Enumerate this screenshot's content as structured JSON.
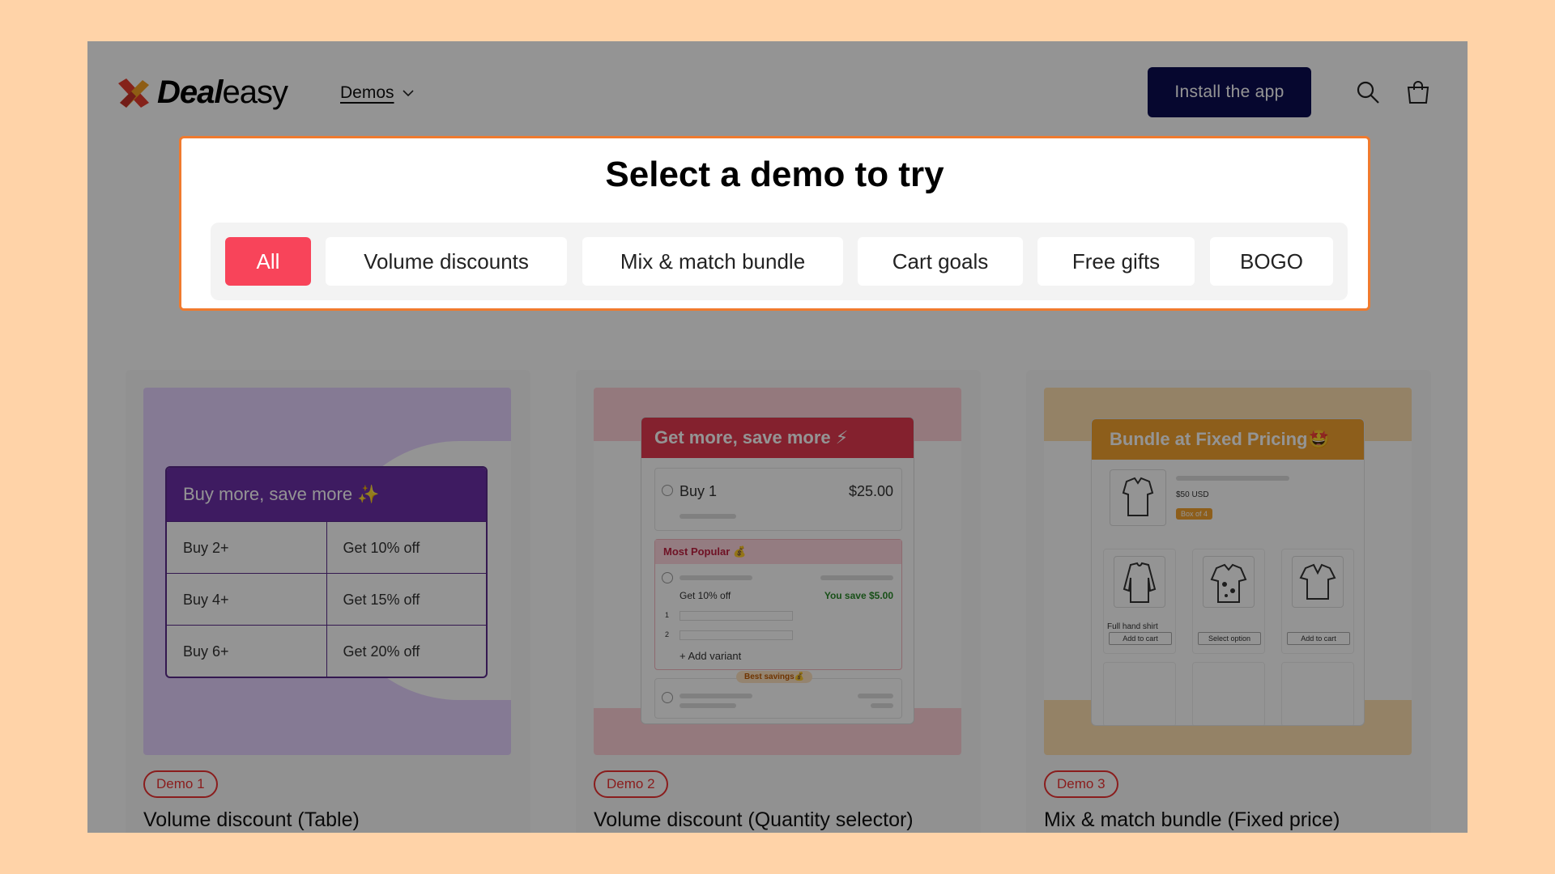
{
  "brand": {
    "bold": "Deal",
    "light": "easy"
  },
  "nav": {
    "demos_label": "Demos"
  },
  "header": {
    "install_label": "Install the app"
  },
  "panel": {
    "title": "Select a demo to try",
    "tabs": [
      "All",
      "Volume discounts",
      "Mix & match bundle",
      "Cart goals",
      "Free gifts",
      "BOGO"
    ],
    "active_tab": "All"
  },
  "cards": [
    {
      "badge": "Demo 1",
      "title": "Volume discount (Table)",
      "widget": {
        "heading": "Buy more, save more ✨",
        "rows": [
          {
            "qty": "Buy 2+",
            "deal": "Get 10% off"
          },
          {
            "qty": "Buy 4+",
            "deal": "Get 15% off"
          },
          {
            "qty": "Buy 6+",
            "deal": "Get 20% off"
          }
        ]
      }
    },
    {
      "badge": "Demo 2",
      "title": "Volume discount (Quantity selector)",
      "widget": {
        "heading": "Get more, save more ⚡",
        "buy1_label": "Buy 1",
        "buy1_price": "$25.00",
        "popular_label": "Most Popular 💰",
        "discount_label": "Get 10% off",
        "save_label": "You save $5.00",
        "row1": "1",
        "row2": "2",
        "add_variant": "+ Add variant",
        "best_label": "Best savings💰"
      }
    },
    {
      "badge": "Demo 3",
      "title": "Mix & match bundle (Fixed price)",
      "widget": {
        "heading": "Bundle at Fixed Pricing🤩",
        "price": "$50 USD",
        "box_label": "Box of 4",
        "product1_name": "Full hand shirt",
        "btn1": "Add to cart",
        "btn2": "Select option",
        "btn3": "Add to cart"
      }
    }
  ],
  "colors": {
    "background": "#ffd3a8",
    "install": "#0b0d52",
    "active_tab": "#f8445a",
    "panel_border": "#f07a2e"
  }
}
